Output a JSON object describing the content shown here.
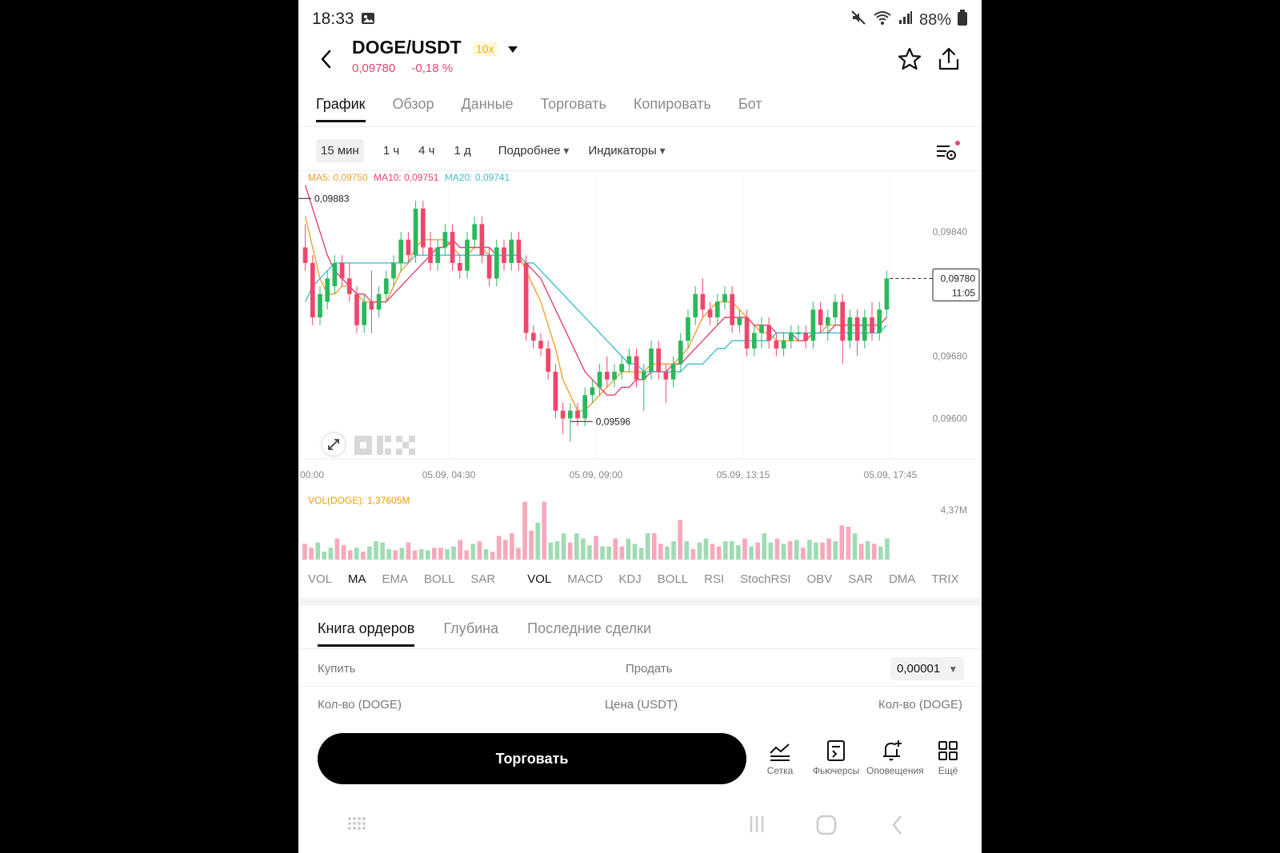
{
  "status": {
    "time": "18:33",
    "battery": "88%"
  },
  "header": {
    "pair": "DOGE/USDT",
    "leverage": "10x",
    "last_price": "0,09780",
    "change": "-0,18 %",
    "icons": [
      "back-icon",
      "dropdown-icon",
      "star-icon",
      "share-icon"
    ]
  },
  "tabs": [
    "График",
    "Обзор",
    "Данные",
    "Торговать",
    "Копировать",
    "Бот"
  ],
  "timeframes": [
    "15 мин",
    "1 ч",
    "4 ч",
    "1 д"
  ],
  "menus": {
    "more": "Подробнее",
    "indicators": "Индикаторы"
  },
  "ma": {
    "ma5": "MA5: 0,09750",
    "ma10": "MA10: 0,09751",
    "ma20": "MA20: 0,09741"
  },
  "chart_labels": {
    "high": "0,09883",
    "low": "0,09596",
    "current_price": "0,09780",
    "countdown": "11:05",
    "watermark": "OKX"
  },
  "vol_label": "VOL(DOGE): 1,37605M",
  "chart_data": [
    {
      "type": "candlestick",
      "y_ticks": [
        "0,09840",
        "0,09680",
        "0,09600"
      ],
      "x_ticks": [
        "00:00",
        "05.09, 04:30",
        "05.09, 09:00",
        "05.09, 13:15",
        "05.09, 17:45"
      ],
      "ylim": [
        0.0955,
        0.0991
      ],
      "candles": [
        [
          0.0982,
          0.0985,
          0.0979,
          0.098
        ],
        [
          0.098,
          0.0981,
          0.0972,
          0.0973
        ],
        [
          0.0973,
          0.0977,
          0.0972,
          0.0976
        ],
        [
          0.0975,
          0.0979,
          0.0974,
          0.0978
        ],
        [
          0.0977,
          0.0981,
          0.0976,
          0.098
        ],
        [
          0.098,
          0.0981,
          0.0977,
          0.0978
        ],
        [
          0.0978,
          0.098,
          0.0975,
          0.0976
        ],
        [
          0.0976,
          0.0977,
          0.0971,
          0.0972
        ],
        [
          0.0972,
          0.0976,
          0.0971,
          0.0975
        ],
        [
          0.0975,
          0.0979,
          0.0971,
          0.0974
        ],
        [
          0.0974,
          0.0977,
          0.0973,
          0.0976
        ],
        [
          0.0976,
          0.0979,
          0.0975,
          0.0978
        ],
        [
          0.0978,
          0.0981,
          0.0977,
          0.098
        ],
        [
          0.098,
          0.0984,
          0.0979,
          0.0983
        ],
        [
          0.0983,
          0.0984,
          0.098,
          0.0981
        ],
        [
          0.0981,
          0.0988,
          0.098,
          0.0987
        ],
        [
          0.0987,
          0.0988,
          0.0981,
          0.0982
        ],
        [
          0.0982,
          0.0984,
          0.0979,
          0.098
        ],
        [
          0.098,
          0.0983,
          0.0979,
          0.0982
        ],
        [
          0.0982,
          0.0985,
          0.0981,
          0.0984
        ],
        [
          0.0984,
          0.0985,
          0.0979,
          0.098
        ],
        [
          0.098,
          0.0981,
          0.0978,
          0.0979
        ],
        [
          0.0979,
          0.0984,
          0.0978,
          0.0983
        ],
        [
          0.0983,
          0.0986,
          0.0982,
          0.0985
        ],
        [
          0.0985,
          0.0986,
          0.098,
          0.0981
        ],
        [
          0.0981,
          0.0982,
          0.0977,
          0.0978
        ],
        [
          0.0978,
          0.0983,
          0.0977,
          0.0982
        ],
        [
          0.0982,
          0.0983,
          0.0979,
          0.098
        ],
        [
          0.098,
          0.0984,
          0.0979,
          0.0983
        ],
        [
          0.0983,
          0.0984,
          0.0979,
          0.098
        ],
        [
          0.098,
          0.0981,
          0.097,
          0.0971
        ],
        [
          0.0971,
          0.0972,
          0.0969,
          0.097
        ],
        [
          0.097,
          0.0971,
          0.0968,
          0.0969
        ],
        [
          0.0969,
          0.097,
          0.0965,
          0.0966
        ],
        [
          0.0966,
          0.0967,
          0.096,
          0.0961
        ],
        [
          0.0961,
          0.0962,
          0.0958,
          0.096
        ],
        [
          0.096,
          0.0962,
          0.0957,
          0.0961
        ],
        [
          0.0961,
          0.0962,
          0.0959,
          0.096
        ],
        [
          0.096,
          0.0964,
          0.0959,
          0.0963
        ],
        [
          0.0963,
          0.0965,
          0.0962,
          0.0964
        ],
        [
          0.0964,
          0.0967,
          0.0963,
          0.0966
        ],
        [
          0.0966,
          0.0968,
          0.0964,
          0.0965
        ],
        [
          0.0965,
          0.0967,
          0.0964,
          0.0966
        ],
        [
          0.0966,
          0.0968,
          0.0965,
          0.0967
        ],
        [
          0.0967,
          0.0969,
          0.0966,
          0.0968
        ],
        [
          0.0968,
          0.0969,
          0.0964,
          0.0965
        ],
        [
          0.0965,
          0.0967,
          0.0961,
          0.0966
        ],
        [
          0.0966,
          0.097,
          0.0965,
          0.0969
        ],
        [
          0.0969,
          0.097,
          0.0965,
          0.0966
        ],
        [
          0.0966,
          0.0967,
          0.0962,
          0.0965
        ],
        [
          0.0965,
          0.0968,
          0.0964,
          0.0967
        ],
        [
          0.0967,
          0.0971,
          0.0966,
          0.097
        ],
        [
          0.097,
          0.0974,
          0.0969,
          0.0973
        ],
        [
          0.0973,
          0.0977,
          0.0972,
          0.0976
        ],
        [
          0.0976,
          0.0978,
          0.0973,
          0.0974
        ],
        [
          0.0974,
          0.0975,
          0.0972,
          0.0973
        ],
        [
          0.0973,
          0.0976,
          0.0972,
          0.0975
        ],
        [
          0.0975,
          0.0977,
          0.0974,
          0.0976
        ],
        [
          0.0976,
          0.0977,
          0.0971,
          0.0972
        ],
        [
          0.0972,
          0.0974,
          0.0971,
          0.0973
        ],
        [
          0.0973,
          0.0974,
          0.0968,
          0.0969
        ],
        [
          0.0969,
          0.0972,
          0.0968,
          0.0971
        ],
        [
          0.0971,
          0.0973,
          0.0969,
          0.0972
        ],
        [
          0.0972,
          0.0973,
          0.0969,
          0.097
        ],
        [
          0.097,
          0.0971,
          0.0968,
          0.0969
        ],
        [
          0.0969,
          0.0971,
          0.0968,
          0.097
        ],
        [
          0.097,
          0.0972,
          0.0969,
          0.0971
        ],
        [
          0.0971,
          0.0972,
          0.097,
          0.0971
        ],
        [
          0.0971,
          0.0972,
          0.0969,
          0.097
        ],
        [
          0.097,
          0.0975,
          0.0969,
          0.0974
        ],
        [
          0.0974,
          0.0975,
          0.0971,
          0.0972
        ],
        [
          0.0972,
          0.0974,
          0.097,
          0.0973
        ],
        [
          0.0973,
          0.0976,
          0.0972,
          0.0975
        ],
        [
          0.0975,
          0.0976,
          0.0967,
          0.097
        ],
        [
          0.097,
          0.0974,
          0.0969,
          0.0973
        ],
        [
          0.0973,
          0.0974,
          0.0968,
          0.097
        ],
        [
          0.097,
          0.0974,
          0.0969,
          0.0973
        ],
        [
          0.0973,
          0.0975,
          0.097,
          0.0971
        ],
        [
          0.0971,
          0.0975,
          0.097,
          0.0974
        ],
        [
          0.0974,
          0.0979,
          0.0973,
          0.0978
        ]
      ],
      "ma_series": [
        {
          "name": "MA5",
          "values": [
            0.0986,
            0.0982,
            0.0978,
            0.0976,
            0.0976,
            0.0977,
            0.0977,
            0.0976,
            0.0975,
            0.0975,
            0.0975,
            0.0975,
            0.0977,
            0.0979,
            0.098,
            0.0982,
            0.0983,
            0.0983,
            0.0983,
            0.0983,
            0.0982,
            0.0981,
            0.0981,
            0.0982,
            0.0982,
            0.0981,
            0.0981,
            0.0981,
            0.0981,
            0.0981,
            0.0979,
            0.0977,
            0.0975,
            0.0972,
            0.0969,
            0.0965,
            0.0963,
            0.0961,
            0.0961,
            0.0962,
            0.0963,
            0.0964,
            0.0965,
            0.0966,
            0.0966,
            0.0966,
            0.0966,
            0.0967,
            0.0967,
            0.0967,
            0.0967,
            0.0968,
            0.0969,
            0.0971,
            0.0973,
            0.0974,
            0.0975,
            0.0975,
            0.0975,
            0.0974,
            0.0973,
            0.0972,
            0.0971,
            0.0971,
            0.097,
            0.097,
            0.097,
            0.097,
            0.097,
            0.0971,
            0.0971,
            0.0972,
            0.0972,
            0.0972,
            0.0972,
            0.0972,
            0.0972,
            0.0972,
            0.0972,
            0.0973
          ]
        },
        {
          "name": "MA10",
          "values": [
            0.099,
            0.0987,
            0.0984,
            0.0981,
            0.0979,
            0.0978,
            0.0977,
            0.0976,
            0.0976,
            0.0975,
            0.0975,
            0.0975,
            0.0976,
            0.0977,
            0.0978,
            0.0979,
            0.098,
            0.0981,
            0.0982,
            0.0982,
            0.0983,
            0.0982,
            0.0982,
            0.0982,
            0.0982,
            0.0982,
            0.0981,
            0.0981,
            0.0981,
            0.0981,
            0.098,
            0.0979,
            0.0978,
            0.0976,
            0.0974,
            0.0972,
            0.097,
            0.0968,
            0.0966,
            0.0965,
            0.0964,
            0.0963,
            0.0963,
            0.0964,
            0.0964,
            0.0965,
            0.0965,
            0.0966,
            0.0966,
            0.0966,
            0.0967,
            0.0967,
            0.0968,
            0.0969,
            0.097,
            0.0971,
            0.0972,
            0.0973,
            0.0973,
            0.0973,
            0.0973,
            0.0972,
            0.0972,
            0.0972,
            0.0971,
            0.0971,
            0.0971,
            0.097,
            0.097,
            0.0971,
            0.0971,
            0.0971,
            0.0972,
            0.0972,
            0.0972,
            0.0972,
            0.0972,
            0.0972,
            0.0972,
            0.0973
          ]
        },
        {
          "name": "MA20",
          "values": [
            0.0975,
            0.0977,
            0.0978,
            0.0979,
            0.098,
            0.098,
            0.098,
            0.098,
            0.098,
            0.098,
            0.098,
            0.098,
            0.098,
            0.098,
            0.098,
            0.0981,
            0.0981,
            0.0981,
            0.0981,
            0.0981,
            0.0981,
            0.0981,
            0.0981,
            0.0981,
            0.0981,
            0.0981,
            0.0981,
            0.0981,
            0.0981,
            0.0981,
            0.098,
            0.098,
            0.0979,
            0.0978,
            0.0977,
            0.0976,
            0.0975,
            0.0974,
            0.0973,
            0.0972,
            0.0971,
            0.097,
            0.0969,
            0.0968,
            0.0967,
            0.0967,
            0.0966,
            0.0966,
            0.0966,
            0.0966,
            0.0966,
            0.0966,
            0.0967,
            0.0967,
            0.0967,
            0.0968,
            0.0969,
            0.0969,
            0.097,
            0.097,
            0.097,
            0.097,
            0.097,
            0.097,
            0.0971,
            0.0971,
            0.0971,
            0.0971,
            0.0971,
            0.0971,
            0.0971,
            0.0971,
            0.0971,
            0.0971,
            0.0971,
            0.0971,
            0.0971,
            0.0971,
            0.0971,
            0.0972
          ]
        }
      ]
    },
    {
      "type": "bar",
      "name": "VOL(DOGE)",
      "y_ticks": [
        "4,37M"
      ],
      "ylim": [
        0,
        4.37
      ],
      "values_m": [
        1.2,
        0.9,
        1.3,
        0.6,
        0.9,
        1.6,
        1.1,
        0.7,
        0.9,
        0.6,
        1.0,
        1.4,
        1.3,
        0.8,
        0.7,
        0.9,
        1.3,
        0.7,
        0.8,
        0.7,
        0.9,
        0.9,
        0.8,
        1.0,
        1.5,
        0.7,
        1.2,
        1.4,
        0.8,
        0.6,
        1.8,
        1.5,
        2.0,
        0.9,
        4.4,
        2.2,
        2.8,
        4.4,
        1.3,
        1.4,
        2.0,
        1.3,
        2.0,
        1.6,
        1.1,
        1.8,
        1.0,
        1.0,
        1.6,
        1.0,
        1.6,
        1.2,
        0.9,
        2.0,
        2.0,
        1.2,
        1.0,
        1.4,
        3.0,
        1.4,
        0.8,
        1.3,
        1.6,
        1.2,
        1.0,
        1.4,
        1.4,
        1.1,
        1.6,
        1.0,
        1.3,
        2.0,
        1.3,
        1.6,
        1.2,
        1.4,
        1.5,
        0.9,
        1.5,
        1.3,
        1.3,
        1.6,
        1.4,
        2.6,
        2.5,
        2.0,
        1.2,
        1.4,
        1.2,
        1.0,
        1.6
      ],
      "up": [
        false,
        false,
        true,
        true,
        true,
        false,
        false,
        false,
        true,
        false,
        true,
        true,
        true,
        true,
        false,
        true,
        false,
        false,
        true,
        true,
        false,
        false,
        true,
        true,
        false,
        false,
        true,
        false,
        true,
        false,
        false,
        false,
        false,
        false,
        false,
        false,
        true,
        false,
        true,
        true,
        true,
        false,
        true,
        true,
        true,
        false,
        true,
        true,
        false,
        false,
        true,
        true,
        true,
        true,
        false,
        false,
        true,
        true,
        false,
        true,
        false,
        true,
        true,
        false,
        false,
        true,
        true,
        true,
        false,
        true,
        false,
        true,
        true,
        false,
        true,
        false,
        true,
        false,
        true,
        true,
        false,
        false,
        true,
        false,
        false,
        true,
        false,
        true,
        false,
        true,
        true
      ]
    }
  ],
  "indicators_main": [
    "VOL",
    "MA",
    "EMA",
    "BOLL",
    "SAR"
  ],
  "indicators_sub": [
    "VOL",
    "MACD",
    "KDJ",
    "BOLL",
    "RSI",
    "StochRSI",
    "OBV",
    "SAR",
    "DMA",
    "TRIX"
  ],
  "orderbook": {
    "tabs": [
      "Книга ордеров",
      "Глубина",
      "Последние сделки"
    ],
    "buy": "Купить",
    "sell": "Продать",
    "step": "0,00001",
    "col_qty_left": "Кол-во (DOGE)",
    "col_price": "Цена (USDT)",
    "col_qty_right": "Кол-во (DOGE)"
  },
  "bottom": {
    "trade_button": "Торговать",
    "tools": [
      {
        "label": "Сетка",
        "icon": "grid-chart-icon"
      },
      {
        "label": "Фьючерсы",
        "icon": "futures-icon"
      },
      {
        "label": "Оповещения",
        "icon": "alert-bell-icon"
      },
      {
        "label": "Ещё",
        "icon": "more-apps-icon"
      }
    ]
  },
  "colors": {
    "up": "#2db75b",
    "down": "#f0466c",
    "ma5": "#f0a030",
    "ma10": "#e0456f",
    "ma20": "#3cc0d0",
    "accent": "#e6b400"
  }
}
